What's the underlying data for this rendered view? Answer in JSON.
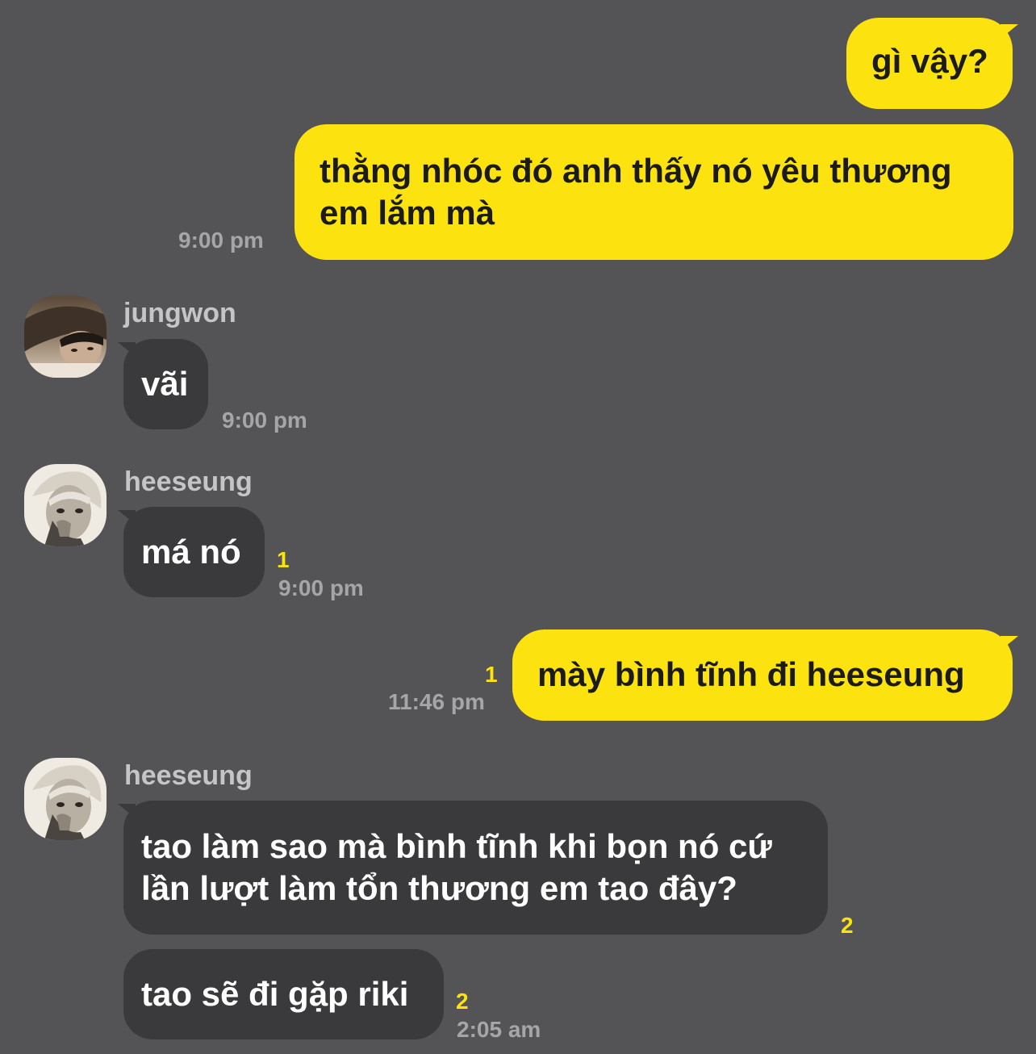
{
  "messages": [
    {
      "id": "m1",
      "direction": "outgoing",
      "text": "gì vậy?",
      "time": "",
      "unread": ""
    },
    {
      "id": "m2",
      "direction": "outgoing",
      "text": "thằng nhóc đó anh thấy nó yêu thương em lắm mà",
      "time": "9:00 pm",
      "unread": ""
    },
    {
      "id": "m3",
      "direction": "incoming",
      "sender": "jungwon",
      "text": "vãi",
      "time": "9:00 pm",
      "unread": ""
    },
    {
      "id": "m4",
      "direction": "incoming",
      "sender": "heeseung",
      "text": "má nó",
      "time": "9:00 pm",
      "unread": "1"
    },
    {
      "id": "m5",
      "direction": "outgoing",
      "text": "mày bình tĩnh đi heeseung",
      "time": "11:46 pm",
      "unread": "1"
    },
    {
      "id": "m6",
      "direction": "incoming",
      "sender": "heeseung",
      "text": "tao làm sao mà bình tĩnh khi bọn nó cứ lần lượt làm tổn thương em tao đây?",
      "time": "",
      "unread": "2"
    },
    {
      "id": "m7",
      "direction": "incoming",
      "sender": "heeseung",
      "text": "tao sẽ đi gặp riki",
      "time": "2:05 am",
      "unread": "2"
    }
  ],
  "colors": {
    "background": "#545355",
    "outgoing_bubble": "#fce30f",
    "incoming_bubble": "#3a393b",
    "unread_count": "#fce30f",
    "timestamp": "#a6a5a8"
  }
}
